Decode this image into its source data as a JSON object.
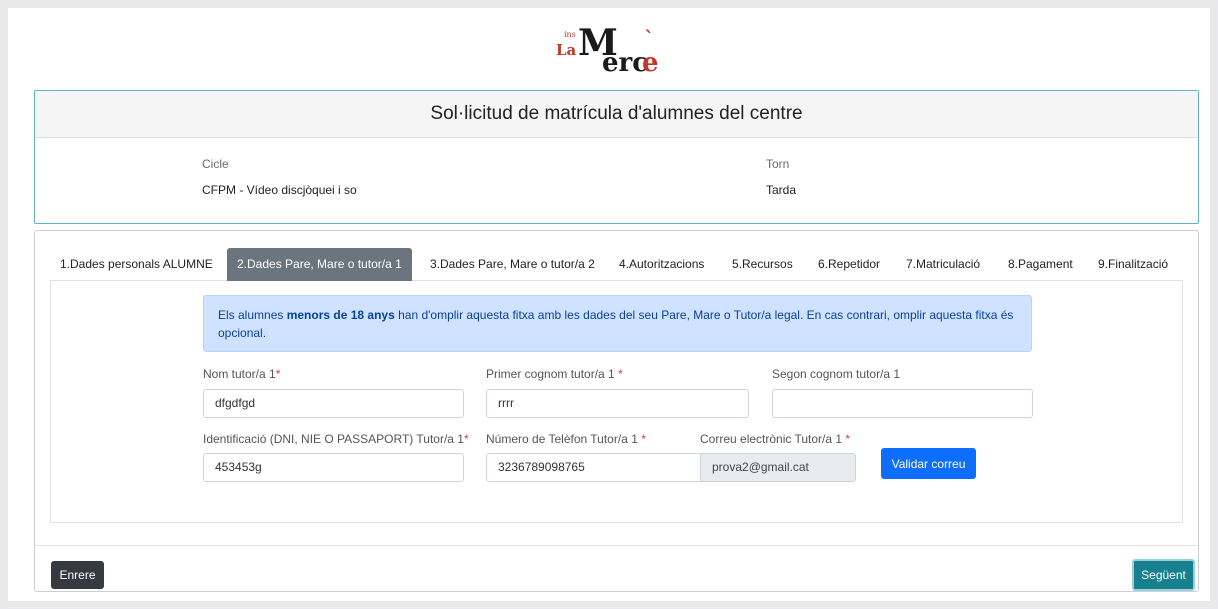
{
  "logo": {
    "small_top": "ins",
    "small_bottom": "La",
    "big1": "M",
    "big2": "erc",
    "big3": "e",
    "accent": "`"
  },
  "header": {
    "title": "Sol·licitud de matrícula d'alumnes del centre",
    "cicle_label": "Cicle",
    "cicle_value": "CFPM - Vídeo discjòquei i so",
    "torn_label": "Torn",
    "torn_value": "Tarda"
  },
  "tabs": [
    "1.Dades personals ALUMNE",
    "2.Dades Pare, Mare o tutor/a 1",
    "3.Dades Pare, Mare o tutor/a 2",
    "4.Autoritzacions",
    "5.Recursos",
    "6.Repetidor",
    "7.Matriculació",
    "8.Pagament",
    "9.Finalització"
  ],
  "alert": {
    "text_before": "Els alumnes ",
    "text_bold": "menors de 18 anys",
    "text_after": " han d'omplir aquesta fitxa amb les dades del seu Pare, Mare o Tutor/a legal. En cas contrari, omplir aquesta fitxa és opcional."
  },
  "form": {
    "nom_label": "Nom tutor/a 1",
    "nom_value": "dfgdfgd",
    "cognom1_label": "Primer cognom tutor/a 1 ",
    "cognom1_value": "rrrr",
    "cognom2_label": "Segon cognom tutor/a 1",
    "cognom2_value": "",
    "ident_label": "Identificació (DNI, NIE O PASSAPORT) Tutor/a 1",
    "ident_value": "453453g",
    "telefon_label": "Número de Telèfon Tutor/a 1 ",
    "telefon_value": "3236789098765",
    "correu_label": "Correu electrònic Tutor/a 1 ",
    "correu_value": "prova2@gmail.cat",
    "required_mark": "*",
    "validar_button": "Validar correu"
  },
  "footer": {
    "back_button": "Enrere",
    "next_button": "Següent"
  },
  "colors": {
    "accent_teal": "#17808f",
    "primary_blue": "#0d6efd",
    "active_tab": "#6c757d",
    "alert_bg": "#cfe2ff",
    "logo_red": "#c0392b"
  }
}
